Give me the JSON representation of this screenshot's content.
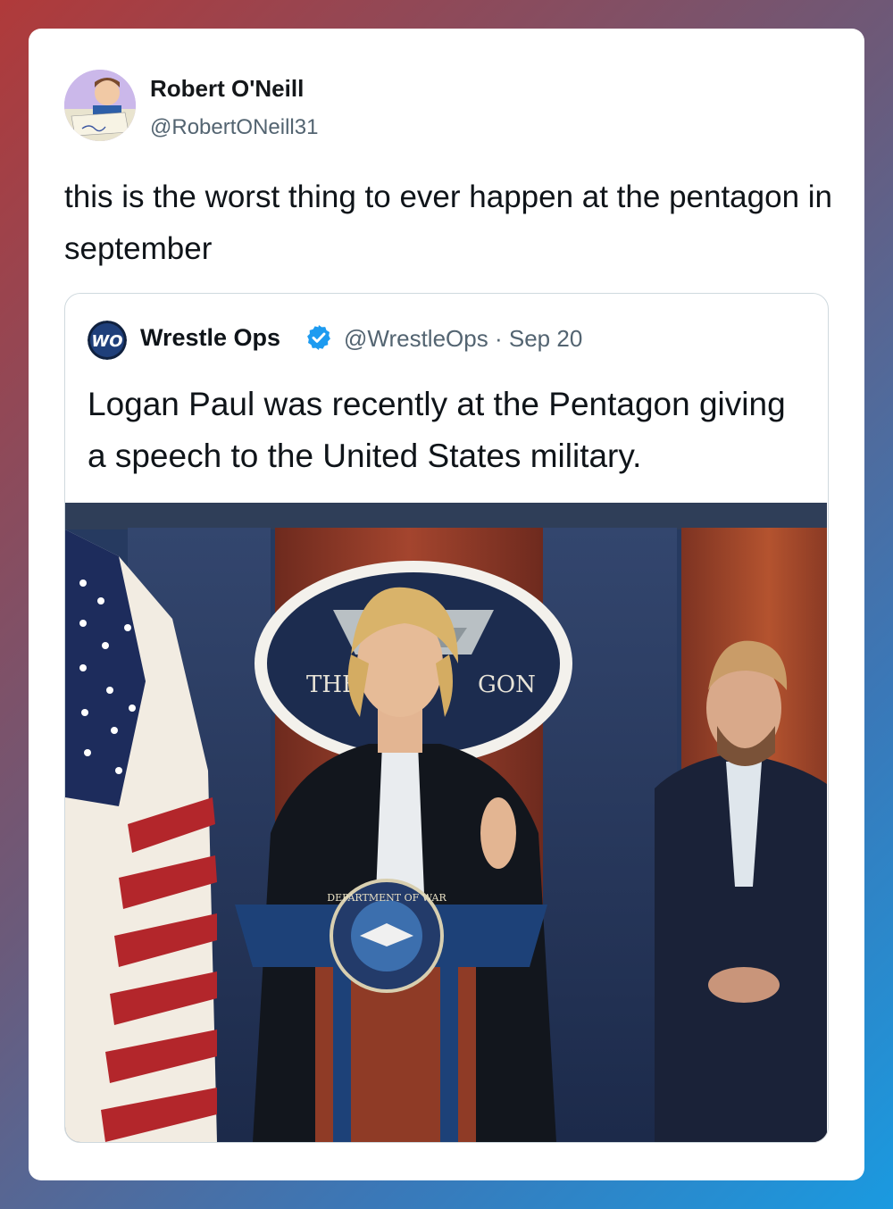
{
  "tweet": {
    "author_name": "Robert O'Neill",
    "author_handle": "@RobertONeill31",
    "text": "this is the worst thing to ever happen at the pentagon in september"
  },
  "quoted_tweet": {
    "author_name": "Wrestle Ops",
    "avatar_logo_text": "WO",
    "author_handle": "@WrestleOps",
    "separator": "·",
    "date": "Sep 20",
    "text": "Logan Paul was recently at the Pentagon giving a speech to the United States military.",
    "image": {
      "seal_text_left": "THE",
      "seal_text_right": "GON",
      "podium_seal_text": "DEPARTMENT OF WAR"
    }
  },
  "icons": {
    "verified": "verified-badge-icon"
  },
  "colors": {
    "verified_blue": "#1d9bf0",
    "text_primary": "#0f1419",
    "text_secondary": "#536471",
    "border": "#cfd9de"
  }
}
